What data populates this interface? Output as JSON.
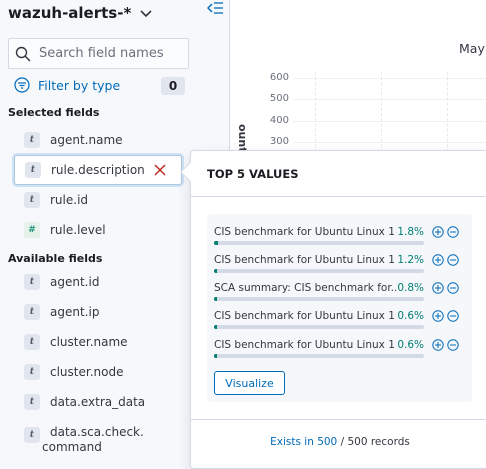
{
  "sidebar": {
    "index_pattern": "wazuh-alerts-*",
    "search_placeholder": "Search field names",
    "filter_label": "Filter by type",
    "filter_count": "0",
    "selected_title": "Selected fields",
    "available_title": "Available fields",
    "selected_fields": [
      {
        "type": "t",
        "name": "agent.name"
      },
      {
        "type": "t",
        "name": "rule.description"
      },
      {
        "type": "t",
        "name": "rule.id"
      },
      {
        "type": "#",
        "name": "rule.level"
      }
    ],
    "available_fields": [
      {
        "type": "t",
        "name": "agent.id"
      },
      {
        "type": "t",
        "name": "agent.ip"
      },
      {
        "type": "t",
        "name": "cluster.name"
      },
      {
        "type": "t",
        "name": "cluster.node"
      },
      {
        "type": "t",
        "name": "data.extra_data"
      },
      {
        "type": "t",
        "name_line1": "data.sca.check.",
        "name_line2": "command"
      }
    ]
  },
  "chart": {
    "month": "May",
    "ylabel": "ount",
    "yticks": [
      "600",
      "500",
      "400",
      "300"
    ]
  },
  "popover": {
    "title": "TOP 5 VALUES",
    "values": [
      {
        "label": "CIS benchmark for Ubuntu Linux 1...",
        "pct": "1.8%",
        "fraction": 0.018
      },
      {
        "label": "CIS benchmark for Ubuntu Linux 1...",
        "pct": "1.2%",
        "fraction": 0.012
      },
      {
        "label": "SCA summary: CIS benchmark for...",
        "pct": "0.8%",
        "fraction": 0.008
      },
      {
        "label": "CIS benchmark for Ubuntu Linux 1...",
        "pct": "0.6%",
        "fraction": 0.006
      },
      {
        "label": "CIS benchmark for Ubuntu Linux 1...",
        "pct": "0.6%",
        "fraction": 0.006
      }
    ],
    "visualize_label": "Visualize",
    "exists_link": "Exists in 500",
    "records_text": " / 500 records"
  },
  "colors": {
    "accent": "#006bb8",
    "success": "#017d73",
    "danger": "#bd271e"
  }
}
